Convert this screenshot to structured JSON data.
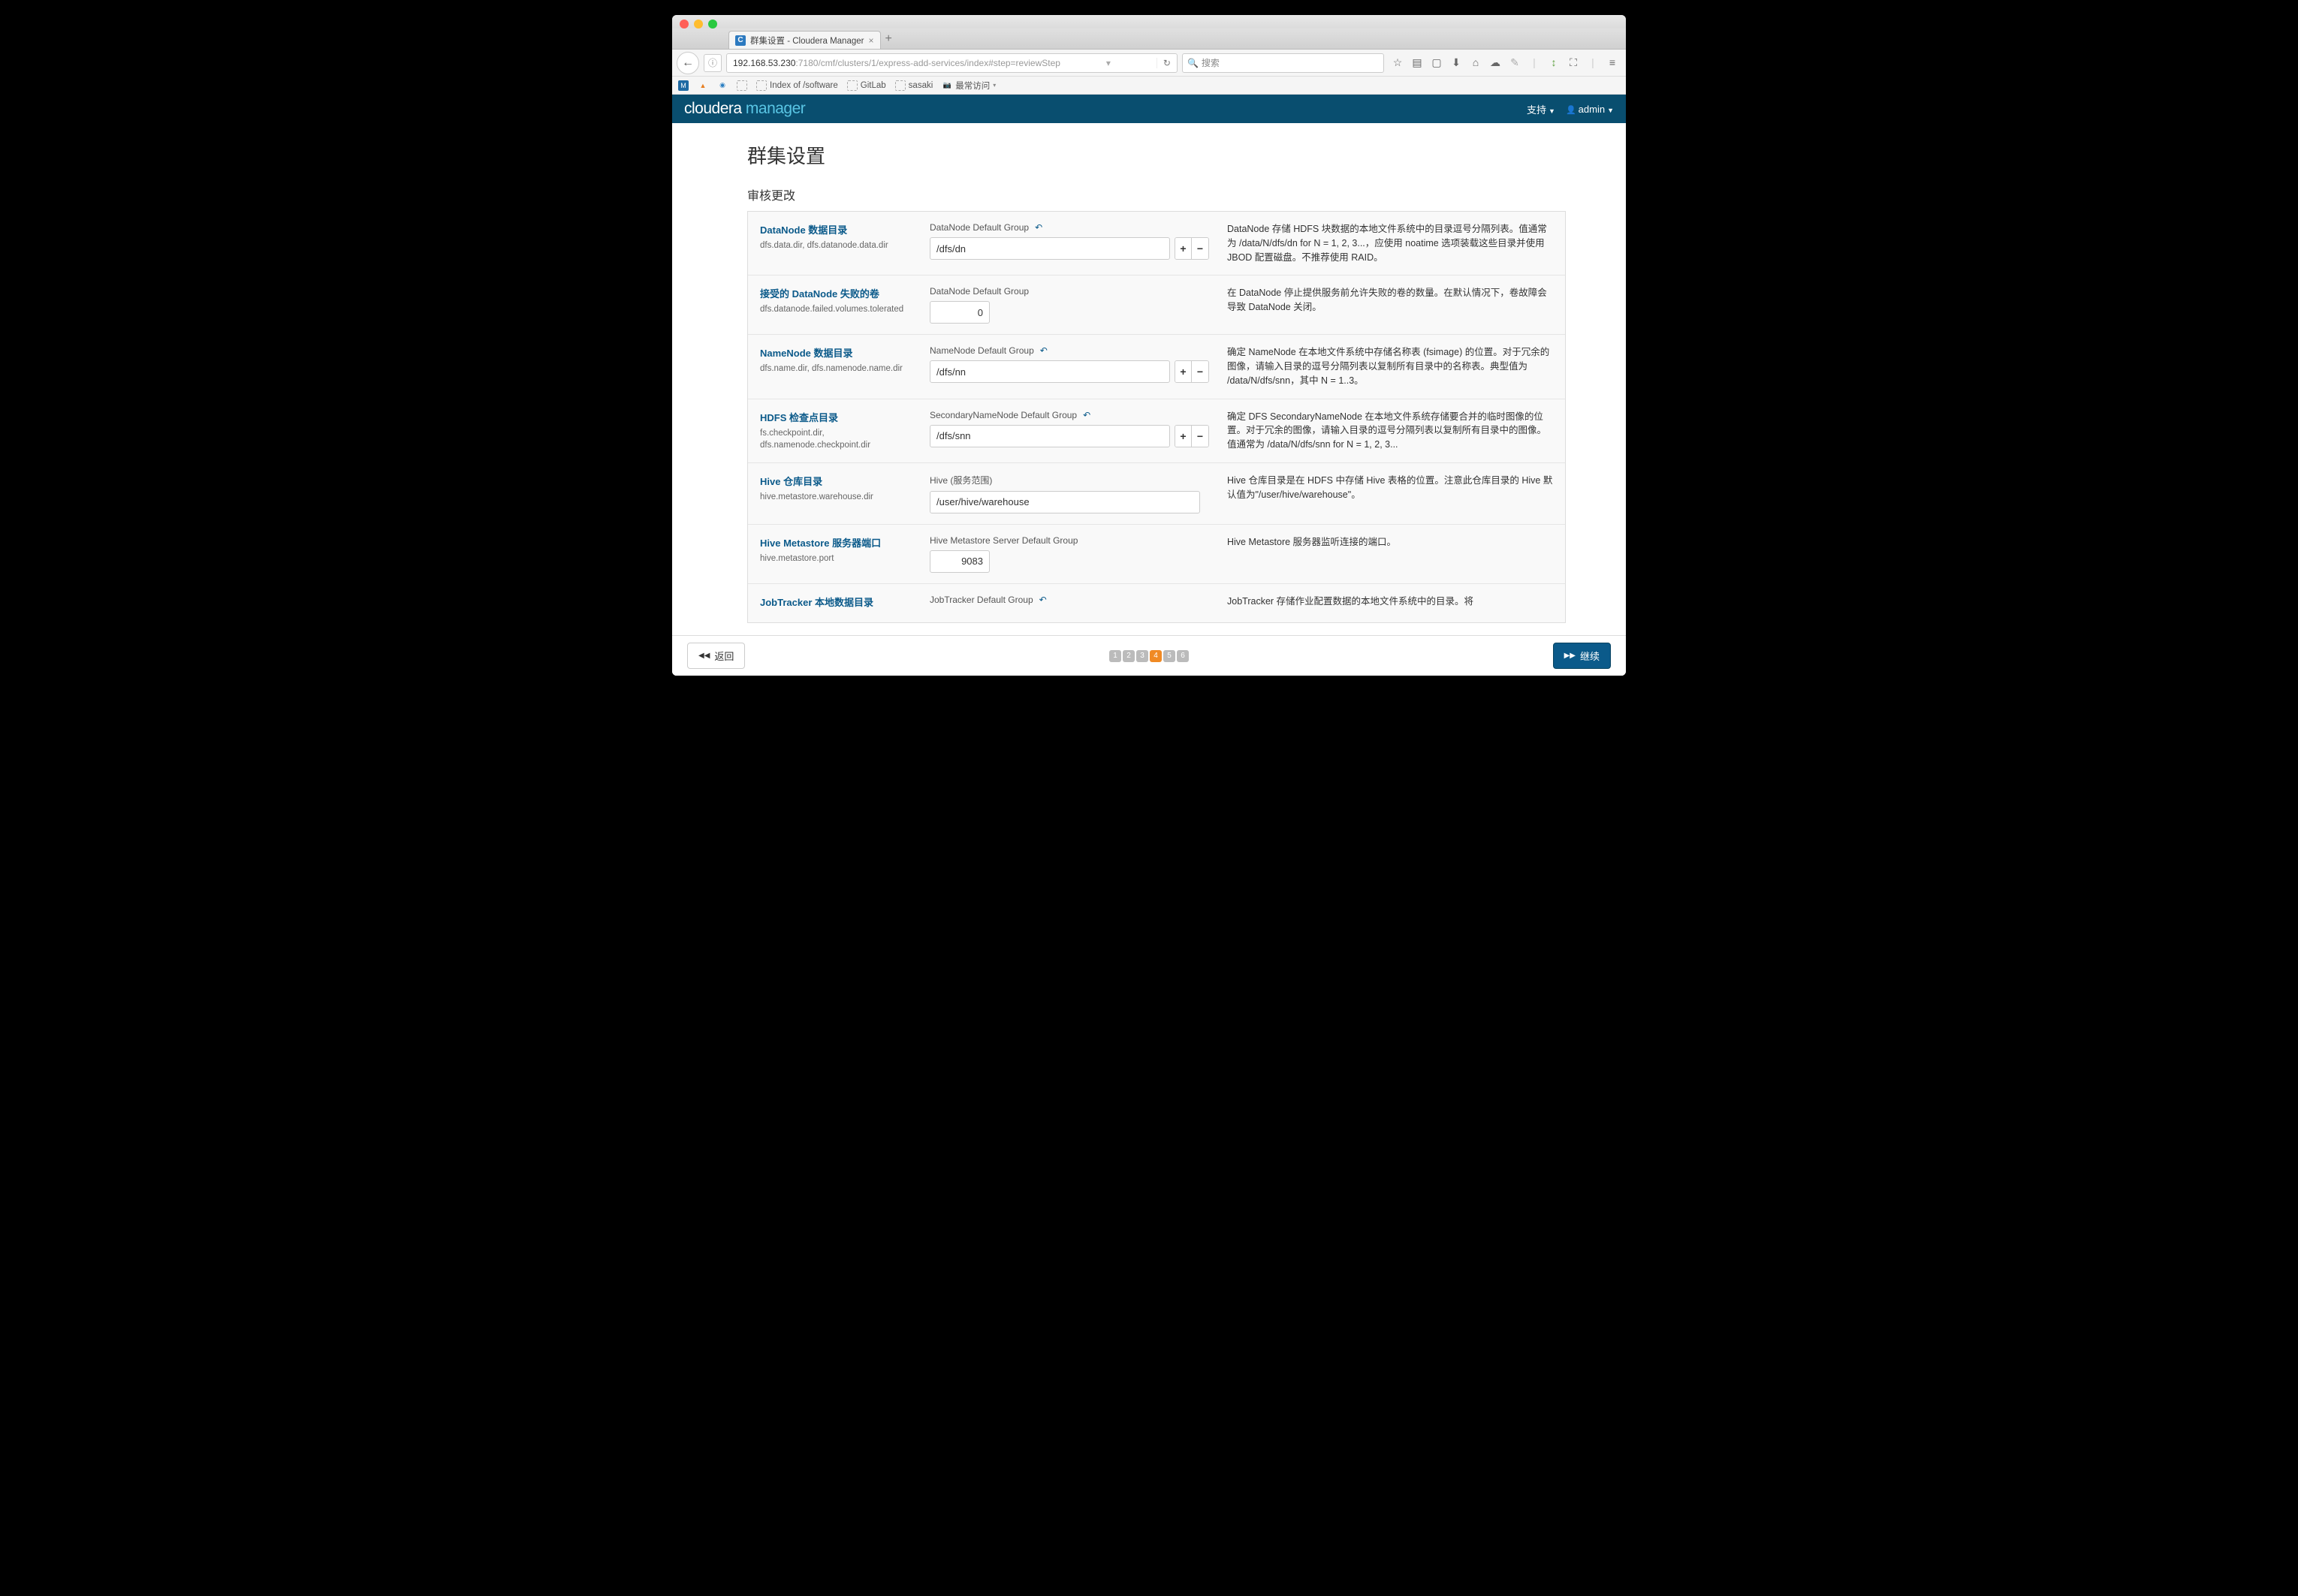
{
  "browser": {
    "tab_title": "群集设置 - Cloudera Manager",
    "url_host": "192.168.53.230",
    "url_path": ":7180/cmf/clusters/1/express-add-services/index#step=reviewStep",
    "search_placeholder": "搜索",
    "bookmarks": [
      "Index of /software",
      "GitLab",
      "sasaki",
      "最常访问"
    ]
  },
  "app": {
    "brand_cloudera": "cloudera",
    "brand_manager": " manager",
    "support": "支持",
    "user": "admin"
  },
  "page": {
    "title": "群集设置",
    "section": "审核更改",
    "back_label": "返回",
    "continue_label": "继续",
    "steps": [
      "1",
      "2",
      "3",
      "4",
      "5",
      "6"
    ],
    "active_step": 4
  },
  "rows": [
    {
      "title": "DataNode 数据目录",
      "sub": "dfs.data.dir, dfs.datanode.data.dir",
      "group": "DataNode Default Group",
      "undo": true,
      "input_type": "text_pm",
      "value": "/dfs/dn",
      "desc": "DataNode 存储 HDFS 块数据的本地文件系统中的目录逗号分隔列表。值通常为 /data/N/dfs/dn for N = 1, 2, 3...，应使用 noatime 选项装载这些目录并使用 JBOD 配置磁盘。不推荐使用 RAID。"
    },
    {
      "title": "接受的 DataNode 失败的卷",
      "sub": "dfs.datanode.failed.volumes.tolerated",
      "group": "DataNode Default Group",
      "undo": false,
      "input_type": "num",
      "value": "0",
      "desc": "在 DataNode 停止提供服务前允许失败的卷的数量。在默认情况下，卷故障会导致 DataNode 关闭。"
    },
    {
      "title": "NameNode 数据目录",
      "sub": "dfs.name.dir, dfs.namenode.name.dir",
      "group": "NameNode Default Group",
      "undo": true,
      "input_type": "text_pm",
      "value": "/dfs/nn",
      "desc": "确定 NameNode 在本地文件系统中存储名称表 (fsimage) 的位置。对于冗余的图像，请输入目录的逗号分隔列表以复制所有目录中的名称表。典型值为 /data/N/dfs/snn，其中 N = 1..3。"
    },
    {
      "title": "HDFS 检查点目录",
      "sub": "fs.checkpoint.dir, dfs.namenode.checkpoint.dir",
      "group": "SecondaryNameNode Default Group",
      "undo": true,
      "input_type": "text_pm",
      "value": "/dfs/snn",
      "desc": "确定 DFS SecondaryNameNode 在本地文件系统存储要合并的临时图像的位置。对于冗余的图像，请输入目录的逗号分隔列表以复制所有目录中的图像。值通常为 /data/N/dfs/snn for N = 1, 2, 3..."
    },
    {
      "title": "Hive 仓库目录",
      "sub": "hive.metastore.warehouse.dir",
      "group": "Hive (服务范围)",
      "undo": false,
      "input_type": "text",
      "value": "/user/hive/warehouse",
      "desc": "Hive 仓库目录是在 HDFS 中存储 Hive 表格的位置。注意此仓库目录的 Hive 默认值为\"/user/hive/warehouse\"。"
    },
    {
      "title": "Hive Metastore 服务器端口",
      "sub": "hive.metastore.port",
      "group": "Hive Metastore Server Default Group",
      "undo": false,
      "input_type": "num",
      "value": "9083",
      "desc": "Hive Metastore 服务器监听连接的端口。"
    },
    {
      "title": "JobTracker 本地数据目录",
      "sub": "",
      "group": "JobTracker Default Group",
      "undo": true,
      "input_type": "none",
      "value": "",
      "desc": "JobTracker 存储作业配置数据的本地文件系统中的目录。将"
    }
  ]
}
